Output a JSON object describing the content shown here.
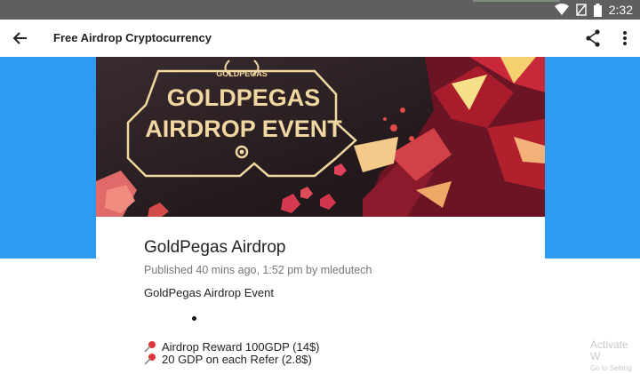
{
  "status": {
    "time": "2:32"
  },
  "toolbar": {
    "title": "Free Airdrop Cryptocurrency",
    "back_icon": "arrow-left-icon",
    "share_icon": "share-icon",
    "more_icon": "more-vert-icon"
  },
  "banner": {
    "brand": "GOLDPEGAS",
    "line1": "GOLDPEGAS",
    "line2": "AIRDROP EVENT"
  },
  "post": {
    "title": "GoldPegas Airdrop",
    "meta": "Published 40 mins ago, 1:52 pm by mledutech",
    "subtitle": "GoldPegas Airdrop Event",
    "lines": [
      "Airdrop Reward 100GDP (14$)",
      "20 GDP on each Refer (2.8$)"
    ]
  },
  "watermark": {
    "line1": "Activate W",
    "line2": "Go to Setting"
  },
  "colors": {
    "accent_blue": "#2e9bf0",
    "status_bar": "#5f5f5f",
    "banner_gold": "#f1d7a1"
  }
}
